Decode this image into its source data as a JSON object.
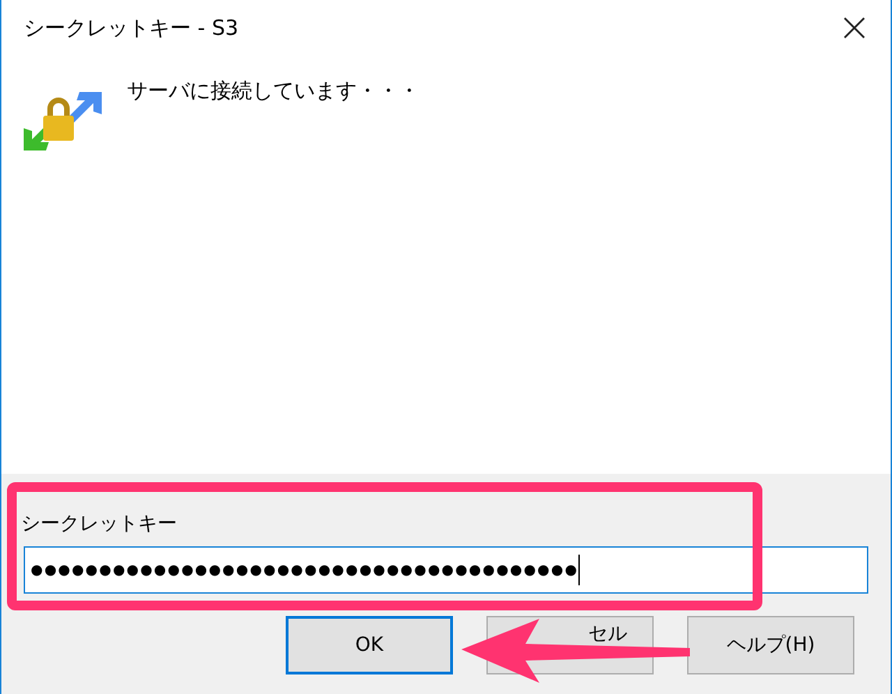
{
  "window": {
    "title": "シークレットキー - S3"
  },
  "message": "サーバに接続しています・・・",
  "field": {
    "label": "シークレットキー",
    "value": "●●●●●●●●●●●●●●●●●●●●●●●●●●●●●●●●●●●●●●●●"
  },
  "buttons": [
    {
      "kind": "ok",
      "label": "OK",
      "default": true
    },
    {
      "kind": "cancel",
      "label": "セル",
      "default": false
    },
    {
      "kind": "help",
      "label": "ヘルプ(H)",
      "default": false
    }
  ]
}
